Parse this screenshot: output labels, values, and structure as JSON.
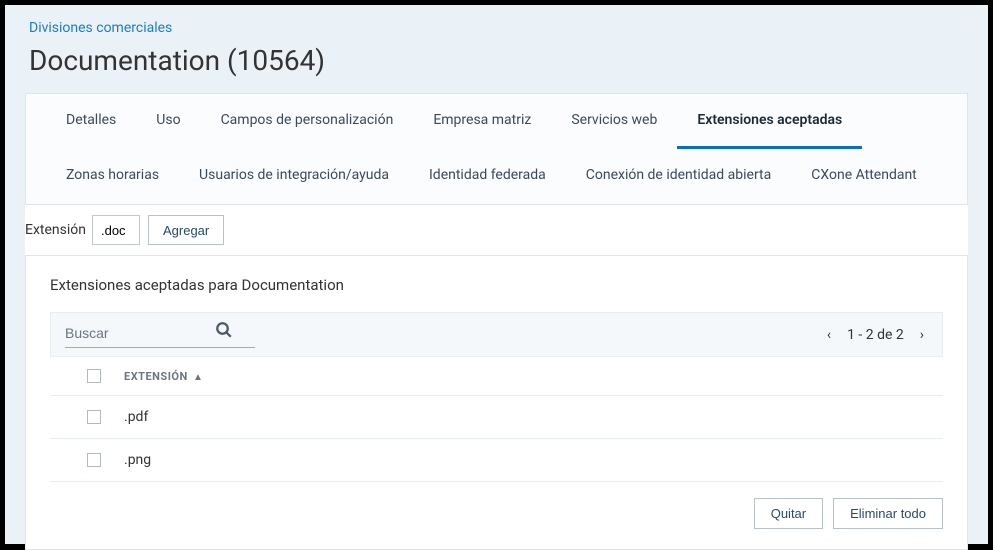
{
  "breadcrumb": "Divisiones comerciales",
  "page_title": "Documentation (10564)",
  "tabs_row1": [
    {
      "label": "Detalles",
      "active": false
    },
    {
      "label": "Uso",
      "active": false
    },
    {
      "label": "Campos de personalización",
      "active": false
    },
    {
      "label": "Empresa matriz",
      "active": false
    },
    {
      "label": "Servicios web",
      "active": false
    },
    {
      "label": "Extensiones aceptadas",
      "active": true
    }
  ],
  "tabs_row2": [
    {
      "label": "Zonas horarias",
      "active": false
    },
    {
      "label": "Usuarios de integración/ayuda",
      "active": false
    },
    {
      "label": "Identidad federada",
      "active": false
    },
    {
      "label": "Conexión de identidad abierta",
      "active": false
    },
    {
      "label": "CXone Attendant",
      "active": false
    }
  ],
  "add_section": {
    "label": "Extensión",
    "input_value": ".doc",
    "button_label": "Agregar"
  },
  "panel": {
    "title": "Extensiones aceptadas para Documentation",
    "search_placeholder": "Buscar",
    "pagination_text": "1 - 2 de 2",
    "column_header": "EXTENSIÓN",
    "rows": [
      {
        "ext": ".pdf"
      },
      {
        "ext": ".png"
      }
    ],
    "remove_label": "Quitar",
    "remove_all_label": "Eliminar todo"
  }
}
